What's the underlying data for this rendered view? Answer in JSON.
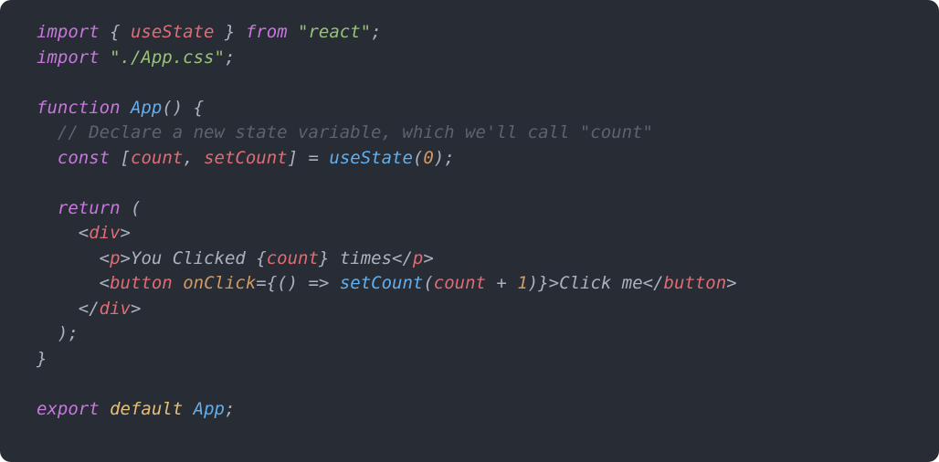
{
  "code": {
    "l1": {
      "import": "import",
      "lbrace": " { ",
      "useState": "useState",
      "rbrace": " } ",
      "from": "from",
      "sp": " ",
      "react": "\"react\"",
      "semi": ";"
    },
    "l2": {
      "import": "import",
      "sp": " ",
      "path": "\"./App.css\"",
      "semi": ";"
    },
    "l3": {
      "function": "function",
      "sp": " ",
      "App": "App",
      "paren": "() {"
    },
    "l4": {
      "indent": "  ",
      "comment": "// Declare a new state variable, which we'll call \"count\""
    },
    "l5": {
      "indent": "  ",
      "const": "const",
      "sp": " ",
      "lb": "[",
      "count": "count",
      "comma": ", ",
      "setCount": "setCount",
      "rb": "]",
      "eq": " = ",
      "useState": "useState",
      "lp": "(",
      "zero": "0",
      "rp": ");"
    },
    "l6": {
      "indent": "  ",
      "return": "return",
      "paren": " ("
    },
    "l7": {
      "indent": "    ",
      "lt": "<",
      "div": "div",
      "gt": ">"
    },
    "l8": {
      "indent": "      ",
      "lt": "<",
      "p": "p",
      "gt": ">",
      "t1": "You Clicked ",
      "lb": "{",
      "count": "count",
      "rb": "}",
      "t2": " times",
      "clt": "</",
      "cp": "p",
      "cgt": ">"
    },
    "l9": {
      "indent": "      ",
      "lt": "<",
      "button": "button",
      "sp": " ",
      "onClick": "onClick",
      "eq": "=",
      "lb": "{",
      "arrow": "() => ",
      "setCount": "setCount",
      "lp": "(",
      "count": "count",
      "plus": " + ",
      "one": "1",
      "rp": ")",
      "rb": "}",
      "gt": ">",
      "text": "Click me",
      "clt": "</",
      "cbutton": "button",
      "cgt": ">"
    },
    "l10": {
      "indent": "    ",
      "clt": "</",
      "div": "div",
      "cgt": ">"
    },
    "l11": {
      "indent": "  ",
      "close": ");"
    },
    "l12": {
      "close": "}"
    },
    "l13": {
      "export": "export",
      "sp": " ",
      "default": "default",
      "sp2": " ",
      "App": "App",
      "semi": ";"
    }
  }
}
